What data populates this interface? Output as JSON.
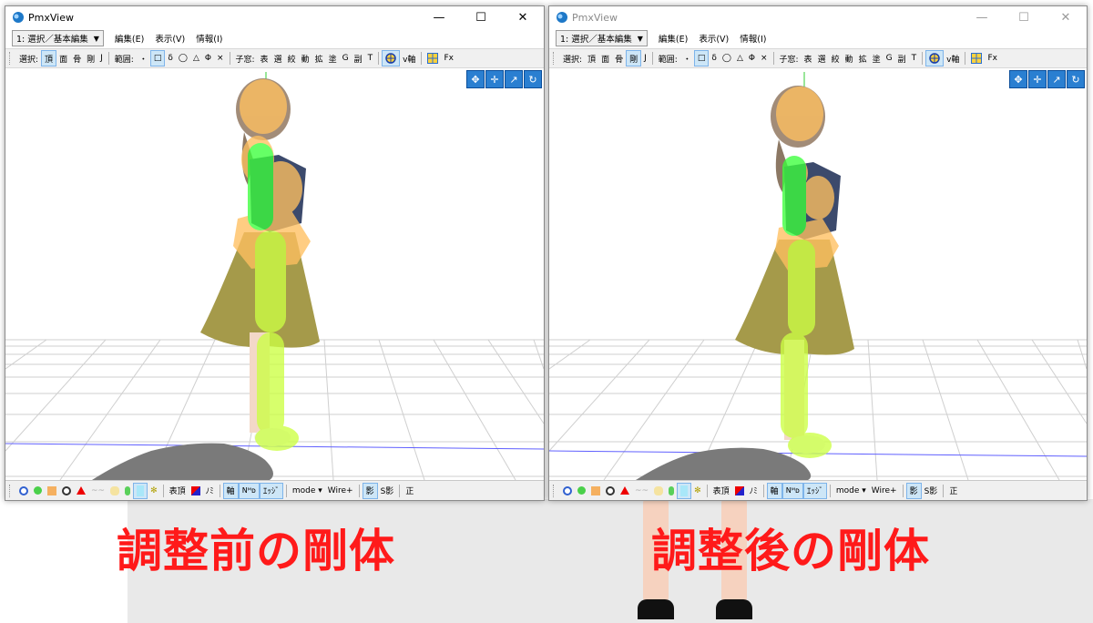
{
  "windows": [
    {
      "id": "left",
      "title": "PmxView",
      "combo_value": "1: 選択／基本編集",
      "menus": [
        "編集(E)",
        "表示(V)",
        "情報(I)"
      ],
      "toolbar": [
        "選択:",
        "頂",
        "面",
        "骨",
        "剛",
        "J",
        "範囲:",
        "・",
        "□",
        "δ",
        "◯",
        "△",
        "Φ",
        "×",
        "子窓:",
        "表",
        "選",
        "絞",
        "動",
        "拡",
        "塗",
        "G",
        "副",
        "T",
        "v軸",
        "Fx"
      ],
      "toolbar_active": [
        1,
        8
      ],
      "status": [
        "表頂",
        "ﾉﾐ",
        "軸",
        "ｴｯｼﾞ",
        "mode ▾",
        "Wire+",
        "影",
        "S影",
        "正"
      ]
    },
    {
      "id": "right",
      "title": "PmxView",
      "combo_value": "1: 選択／基本編集",
      "menus": [
        "編集(E)",
        "表示(V)",
        "情報(I)"
      ],
      "toolbar": [
        "選択:",
        "頂",
        "面",
        "骨",
        "剛",
        "J",
        "範囲:",
        "・",
        "□",
        "δ",
        "◯",
        "△",
        "Φ",
        "×",
        "子窓:",
        "表",
        "選",
        "絞",
        "動",
        "拡",
        "塗",
        "G",
        "副",
        "T",
        "v軸",
        "Fx"
      ],
      "toolbar_active": [
        4,
        8
      ],
      "status": [
        "表頂",
        "ﾉﾐ",
        "軸",
        "ｴｯｼﾞ",
        "mode ▾",
        "Wire+",
        "影",
        "S影",
        "正"
      ]
    }
  ],
  "window_controls": {
    "minimize": "—",
    "maximize": "☐",
    "close": "✕"
  },
  "viewport_icons": [
    "move-xyz-icon",
    "move-xy-icon",
    "rotate-axis-icon",
    "rotate-icon"
  ],
  "captions": {
    "before": "調整前の剛体",
    "after": "調整後の剛体"
  },
  "colors": {
    "caption": "#ff1a1a",
    "rigid_body_green": "#3cff3c",
    "rigid_body_yellow": "#ccff44",
    "rigid_body_orange": "#ffc060",
    "skirt": "#a59a4a"
  }
}
